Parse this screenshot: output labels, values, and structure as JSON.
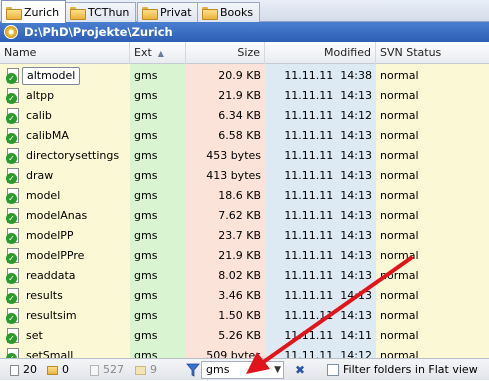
{
  "tabs": [
    {
      "label": "Zurich",
      "active": true
    },
    {
      "label": "TCThun",
      "active": false
    },
    {
      "label": "Privat",
      "active": false
    },
    {
      "label": "Books",
      "active": false
    }
  ],
  "path": "D:\\PhD\\Projekte\\Zurich",
  "columns": {
    "name": "Name",
    "ext": "Ext",
    "size": "Size",
    "modified": "Modified",
    "svn": "SVN Status"
  },
  "sort_column": "ext",
  "files": [
    {
      "name": "altmodel",
      "ext": "gms",
      "size": "20.9 KB",
      "modified": "11.11.11  14:38",
      "svn": "normal"
    },
    {
      "name": "altpp",
      "ext": "gms",
      "size": "21.9 KB",
      "modified": "11.11.11  14:13",
      "svn": "normal"
    },
    {
      "name": "calib",
      "ext": "gms",
      "size": "6.34 KB",
      "modified": "11.11.11  14:12",
      "svn": "normal"
    },
    {
      "name": "calibMA",
      "ext": "gms",
      "size": "6.58 KB",
      "modified": "11.11.11  14:13",
      "svn": "normal"
    },
    {
      "name": "directorysettings",
      "ext": "gms",
      "size": "453 bytes",
      "modified": "11.11.11  14:13",
      "svn": "normal"
    },
    {
      "name": "draw",
      "ext": "gms",
      "size": "413 bytes",
      "modified": "11.11.11  14:13",
      "svn": "normal"
    },
    {
      "name": "model",
      "ext": "gms",
      "size": "18.6 KB",
      "modified": "11.11.11  14:13",
      "svn": "normal"
    },
    {
      "name": "modelAnas",
      "ext": "gms",
      "size": "7.62 KB",
      "modified": "11.11.11  14:13",
      "svn": "normal"
    },
    {
      "name": "modelPP",
      "ext": "gms",
      "size": "23.7 KB",
      "modified": "11.11.11  14:13",
      "svn": "normal"
    },
    {
      "name": "modelPPre",
      "ext": "gms",
      "size": "21.9 KB",
      "modified": "11.11.11  14:13",
      "svn": "normal"
    },
    {
      "name": "readdata",
      "ext": "gms",
      "size": "8.02 KB",
      "modified": "11.11.11  14:13",
      "svn": "normal"
    },
    {
      "name": "results",
      "ext": "gms",
      "size": "3.46 KB",
      "modified": "11.11.11  14:13",
      "svn": "normal"
    },
    {
      "name": "resultsim",
      "ext": "gms",
      "size": "1.50 KB",
      "modified": "11.11.11  14:13",
      "svn": "normal"
    },
    {
      "name": "set",
      "ext": "gms",
      "size": "5.26 KB",
      "modified": "11.11.11  14:11",
      "svn": "normal"
    },
    {
      "name": "setSmall",
      "ext": "gms",
      "size": "509 bytes",
      "modified": "11.11.11  14:12",
      "svn": "normal"
    }
  ],
  "status": {
    "file_count": "20",
    "folder_count": "0",
    "hidden_file_count": "527",
    "hidden_folder_count": "9",
    "filter_value": "gms",
    "filter_folders_label": "Filter folders in Flat view"
  },
  "colors": {
    "name_col": "#fbf9d5",
    "ext_col": "#d8f4d0",
    "size_col": "#fbe3d9",
    "modified_col": "#dde9f3",
    "svn_col": "#fbf9d5",
    "path_bar": "#3a6cc4",
    "annotation_arrow": "#e0141a"
  },
  "icons": {
    "tab": "folder-icon",
    "path": "drive-icon",
    "file": "svn-normal-file-icon",
    "filter": "filter-funnel-icon",
    "clear": "clear-filter-icon"
  }
}
